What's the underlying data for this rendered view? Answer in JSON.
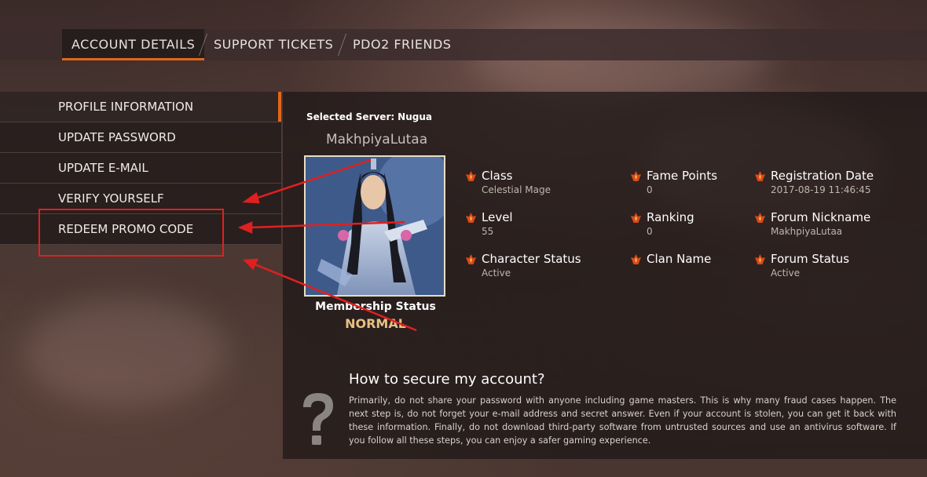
{
  "top_nav": {
    "tabs": [
      {
        "label": "ACCOUNT DETAILS"
      },
      {
        "label": "SUPPORT TICKETS"
      },
      {
        "label": "PDO2 FRIENDS"
      }
    ],
    "active_index": 0
  },
  "side_menu": {
    "items": [
      {
        "label": "PROFILE INFORMATION"
      },
      {
        "label": "UPDATE PASSWORD"
      },
      {
        "label": "UPDATE E-MAIL"
      },
      {
        "label": "VERIFY YOURSELF"
      },
      {
        "label": "REDEEM PROMO CODE"
      }
    ],
    "active_index": 0
  },
  "profile": {
    "server_label": "Selected Server:",
    "server_value": "Nugua",
    "character_name": "MakhpiyaLutaa",
    "membership_label": "Membership Status",
    "membership_value": "NORMAL",
    "fields": [
      {
        "label": "Class",
        "value": "Celestial Mage"
      },
      {
        "label": "Fame Points",
        "value": "0"
      },
      {
        "label": "Registration Date",
        "value": "2017-08-19 11:46:45"
      },
      {
        "label": "Level",
        "value": "55"
      },
      {
        "label": "Ranking",
        "value": "0"
      },
      {
        "label": "Forum Nickname",
        "value": "MakhpiyaLutaa"
      },
      {
        "label": "Character Status",
        "value": "Active"
      },
      {
        "label": "Clan Name",
        "value": ""
      },
      {
        "label": "Forum Status",
        "value": "Active"
      }
    ]
  },
  "help": {
    "title": "How to secure my account?",
    "text": "Primarily, do not share your password with anyone including game masters. This is why many fraud cases happen. The next step is, do not forget your e-mail address and secret answer. Even if your account is stolen, you can get it back with these information. Finally, do not download third-party software from untrusted sources and use an antivirus software. If you follow all these steps, you can enjoy a safer gaming experience.",
    "icon": "question-mark-icon"
  },
  "colors": {
    "accent": "#e1671b",
    "annotation": "#e02020",
    "membership": "#e8c080"
  }
}
